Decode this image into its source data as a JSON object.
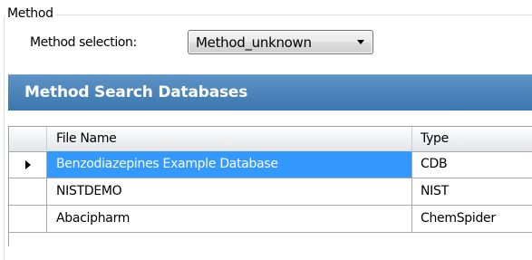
{
  "method_group": {
    "title": "Method",
    "selection_label": "Method selection:",
    "selected_method": "Method_unknown"
  },
  "panel": {
    "title": "Method Search Databases"
  },
  "grid": {
    "columns": [
      "File Name",
      "Type"
    ],
    "rows": [
      {
        "file_name": "Benzodiazepines Example Database",
        "type": "CDB",
        "selected": true
      },
      {
        "file_name": "NISTDEMO",
        "type": "NIST",
        "selected": false
      },
      {
        "file_name": "Abacipharm",
        "type": "ChemSpider",
        "selected": false
      }
    ]
  },
  "colors": {
    "header_gradient_top": "#5d93c6",
    "header_gradient_bottom": "#3c76af",
    "selection": "#3399ff",
    "border": "#a9a9a9"
  },
  "icons": {
    "current_row": "row-pointer-icon",
    "dropdown": "chevron-down-icon"
  }
}
